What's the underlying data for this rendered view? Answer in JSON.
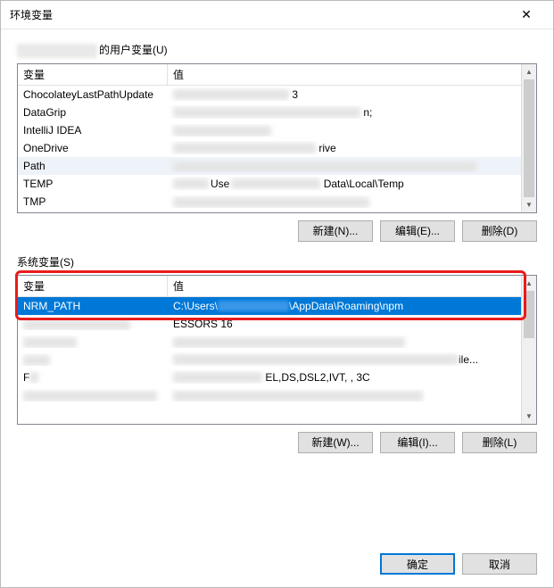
{
  "window": {
    "title": "环境变量",
    "close": "✕"
  },
  "user_section": {
    "label_suffix": "的用户变量(U)",
    "header_var": "变量",
    "header_val": "值",
    "rows": [
      {
        "name": "ChocolateyLastPathUpdate",
        "val_suffix": "3"
      },
      {
        "name": "DataGrip",
        "val_suffix": "n;"
      },
      {
        "name": "IntelliJ IDEA",
        "val_suffix": ""
      },
      {
        "name": "OneDrive",
        "val_suffix": "rive"
      },
      {
        "name": "Path",
        "val_suffix": "",
        "selected": true
      },
      {
        "name": "TEMP",
        "val_prefix_hint": "Use",
        "val_suffix": "Data\\Local\\Temp"
      },
      {
        "name": "TMP",
        "val_suffix": ""
      }
    ],
    "buttons": {
      "new": "新建(N)...",
      "edit": "编辑(E)...",
      "delete": "删除(D)"
    }
  },
  "system_section": {
    "label": "系统变量(S)",
    "header_var": "变量",
    "header_val": "值",
    "rows": [
      {
        "name": "NRM_PATH",
        "val_prefix": "C:\\Users\\",
        "val_suffix": "\\AppData\\Roaming\\npm",
        "selected": true
      },
      {
        "name_hidden": true,
        "val_text": "ESSORS  16"
      },
      {
        "name_hidden": true,
        "val_hidden": true
      },
      {
        "name_hidden": true,
        "val_suffix": "ile..."
      },
      {
        "name_hidden": true,
        "val_prefix_hint": "F",
        "val_suffix": "EL,DS,DSL2,IVT,   , 3C"
      },
      {
        "name_hidden": true,
        "val_hidden": true
      }
    ],
    "buttons": {
      "new": "新建(W)...",
      "edit": "编辑(I)...",
      "delete": "删除(L)"
    }
  },
  "dialog_buttons": {
    "ok": "确定",
    "cancel": "取消"
  }
}
